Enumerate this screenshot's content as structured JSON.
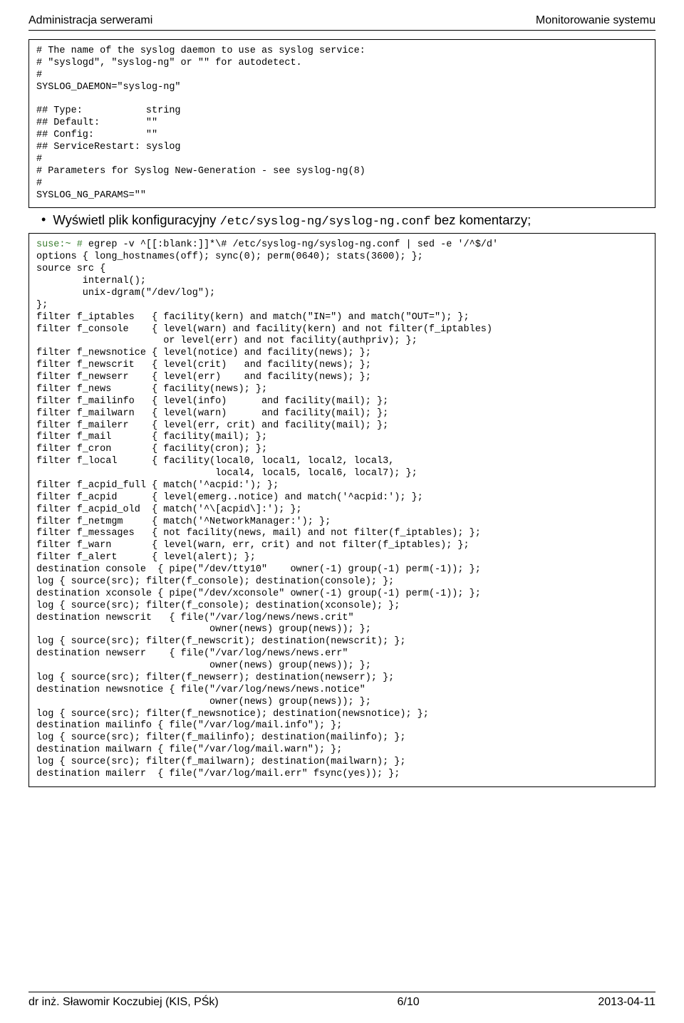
{
  "header": {
    "left": "Administracja serwerami",
    "right": "Monitorowanie systemu"
  },
  "codebox1": {
    "lines": [
      "# The name of the syslog daemon to use as syslog service:",
      "# \"syslogd\", \"syslog-ng\" or \"\" for autodetect.",
      "#",
      "SYSLOG_DAEMON=\"syslog-ng\"",
      "",
      "## Type:           string",
      "## Default:        \"\"",
      "## Config:         \"\"",
      "## ServiceRestart: syslog",
      "#",
      "# Parameters for Syslog New-Generation - see syslog-ng(8)",
      "#",
      "SYSLOG_NG_PARAMS=\"\""
    ]
  },
  "bullet": {
    "pre": "Wyświetl plik konfiguracyjny ",
    "mono": "/etc/syslog-ng/syslog-ng.conf",
    "post": " bez komentarzy;"
  },
  "codebox2": {
    "prompt_prefix": "suse:~ #",
    "prompt_rest": " egrep -v ^[[:blank:]]*\\# /etc/syslog-ng/syslog-ng.conf | sed -e '/^$/d'",
    "lines": [
      "options { long_hostnames(off); sync(0); perm(0640); stats(3600); };",
      "source src {",
      "        internal();",
      "        unix-dgram(\"/dev/log\");",
      "};",
      "filter f_iptables   { facility(kern) and match(\"IN=\") and match(\"OUT=\"); };",
      "filter f_console    { level(warn) and facility(kern) and not filter(f_iptables)",
      "                      or level(err) and not facility(authpriv); };",
      "filter f_newsnotice { level(notice) and facility(news); };",
      "filter f_newscrit   { level(crit)   and facility(news); };",
      "filter f_newserr    { level(err)    and facility(news); };",
      "filter f_news       { facility(news); };",
      "filter f_mailinfo   { level(info)      and facility(mail); };",
      "filter f_mailwarn   { level(warn)      and facility(mail); };",
      "filter f_mailerr    { level(err, crit) and facility(mail); };",
      "filter f_mail       { facility(mail); };",
      "filter f_cron       { facility(cron); };",
      "filter f_local      { facility(local0, local1, local2, local3,",
      "                               local4, local5, local6, local7); };",
      "filter f_acpid_full { match('^acpid:'); };",
      "filter f_acpid      { level(emerg..notice) and match('^acpid:'); };",
      "filter f_acpid_old  { match('^\\[acpid\\]:'); };",
      "filter f_netmgm     { match('^NetworkManager:'); };",
      "filter f_messages   { not facility(news, mail) and not filter(f_iptables); };",
      "filter f_warn       { level(warn, err, crit) and not filter(f_iptables); };",
      "filter f_alert      { level(alert); };",
      "destination console  { pipe(\"/dev/tty10\"    owner(-1) group(-1) perm(-1)); };",
      "log { source(src); filter(f_console); destination(console); };",
      "destination xconsole { pipe(\"/dev/xconsole\" owner(-1) group(-1) perm(-1)); };",
      "log { source(src); filter(f_console); destination(xconsole); };",
      "destination newscrit   { file(\"/var/log/news/news.crit\"",
      "                              owner(news) group(news)); };",
      "log { source(src); filter(f_newscrit); destination(newscrit); };",
      "destination newserr    { file(\"/var/log/news/news.err\"",
      "                              owner(news) group(news)); };",
      "log { source(src); filter(f_newserr); destination(newserr); };",
      "destination newsnotice { file(\"/var/log/news/news.notice\"",
      "                              owner(news) group(news)); };",
      "log { source(src); filter(f_newsnotice); destination(newsnotice); };",
      "destination mailinfo { file(\"/var/log/mail.info\"); };",
      "log { source(src); filter(f_mailinfo); destination(mailinfo); };",
      "destination mailwarn { file(\"/var/log/mail.warn\"); };",
      "log { source(src); filter(f_mailwarn); destination(mailwarn); };",
      "destination mailerr  { file(\"/var/log/mail.err\" fsync(yes)); };"
    ]
  },
  "footer": {
    "left": "dr inż. Sławomir Koczubiej (KIS, PŚk)",
    "center": "6/10",
    "right": "2013-04-11"
  }
}
